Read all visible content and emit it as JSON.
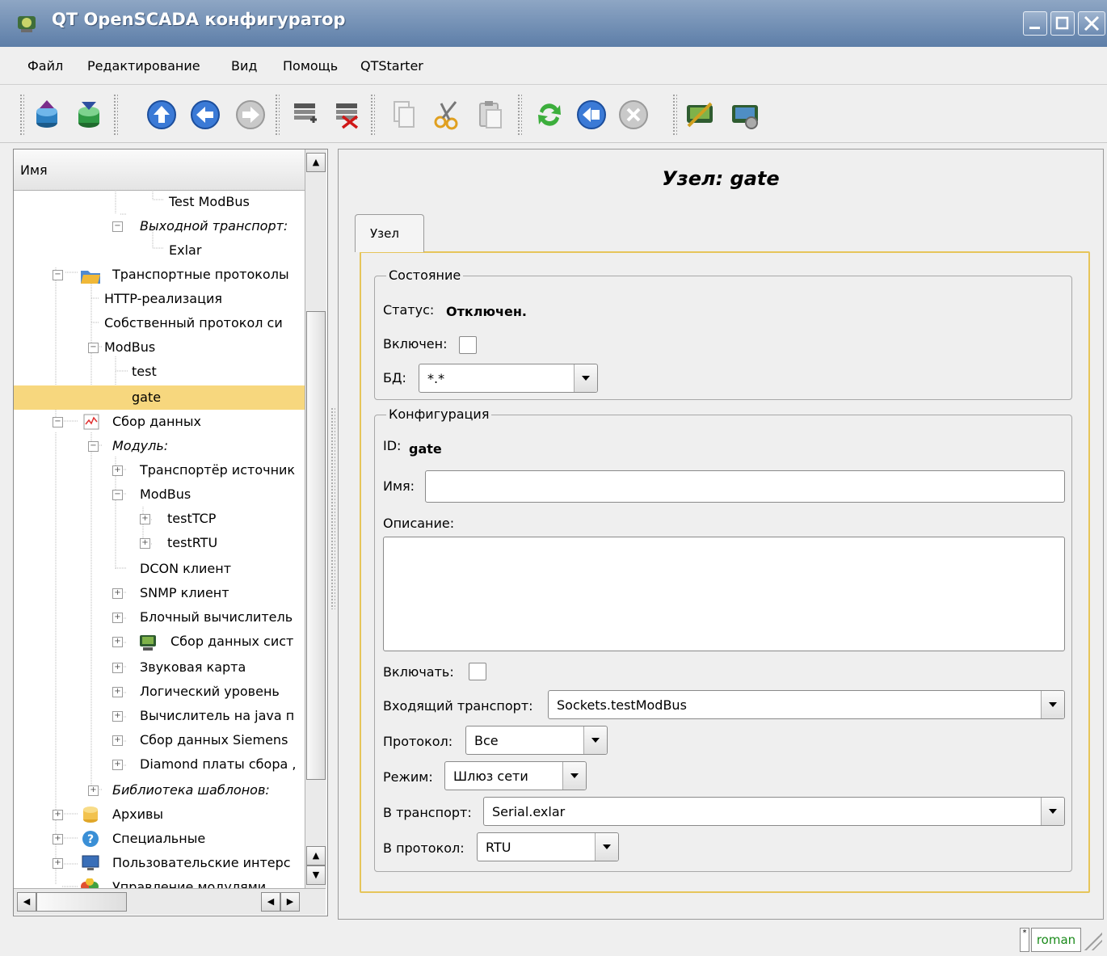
{
  "window": {
    "title": "QT OpenSCADA конфигуратор"
  },
  "menu": [
    {
      "label": "Файл"
    },
    {
      "label": "Редактирование"
    },
    {
      "label": "Вид"
    },
    {
      "label": "Помощь"
    },
    {
      "label": "QTStarter"
    }
  ],
  "toolbar": {
    "icons": [
      "load-db-icon",
      "save-db-icon",
      "up-icon",
      "back-icon",
      "forward-icon",
      "add-item-icon",
      "delete-item-icon",
      "copy-icon",
      "cut-icon",
      "paste-icon",
      "refresh-icon",
      "start-icon",
      "stop-icon",
      "configurator-icon",
      "module-manager-icon"
    ]
  },
  "tree": {
    "header": "Имя",
    "items": [
      {
        "label": "Test ModBus",
        "italic": false
      },
      {
        "label": "Выходной транспорт:",
        "italic": true
      },
      {
        "label": "Exlar",
        "italic": false
      },
      {
        "label": "Транспортные протоколы",
        "italic": false
      },
      {
        "label": "HTTP-реализация",
        "italic": false
      },
      {
        "label": "Собственный протокол си",
        "italic": false
      },
      {
        "label": "ModBus",
        "italic": false
      },
      {
        "label": "test",
        "italic": false
      },
      {
        "label": "gate",
        "italic": false
      },
      {
        "label": "Сбор данных",
        "italic": false
      },
      {
        "label": "Модуль:",
        "italic": true
      },
      {
        "label": "Транспортёр источник",
        "italic": false
      },
      {
        "label": "ModBus",
        "italic": false
      },
      {
        "label": "testTCP",
        "italic": false
      },
      {
        "label": "testRTU",
        "italic": false
      },
      {
        "label": "DCON клиент",
        "italic": false
      },
      {
        "label": "SNMP клиент",
        "italic": false
      },
      {
        "label": "Блочный вычислитель",
        "italic": false
      },
      {
        "label": "Сбор данных сист",
        "italic": false
      },
      {
        "label": "Звуковая карта",
        "italic": false
      },
      {
        "label": "Логический уровень",
        "italic": false
      },
      {
        "label": "Вычислитель на java п",
        "italic": false
      },
      {
        "label": "Сбор данных Siemens",
        "italic": false
      },
      {
        "label": "Diamond платы сбора ,",
        "italic": false
      },
      {
        "label": "Библиотека шаблонов:",
        "italic": true
      },
      {
        "label": "Архивы",
        "italic": false
      },
      {
        "label": "Специальные",
        "italic": false
      },
      {
        "label": "Пользовательские интерс",
        "italic": false
      },
      {
        "label": "Управление модулями",
        "italic": false
      }
    ],
    "selected": "gate"
  },
  "page": {
    "title": "Узел: gate",
    "tab": "Узел",
    "state_group": {
      "title": "Состояние",
      "status_label": "Статус:",
      "status_value": "Отключен.",
      "enabled_label": "Включен:",
      "db_label": "БД:",
      "db_value": "*.*"
    },
    "config_group": {
      "title": "Конфигурация",
      "id_label": "ID:",
      "id_value": "gate",
      "name_label": "Имя:",
      "name_value": "",
      "descr_label": "Описание:",
      "descr_value": "",
      "to_enable_label": "Включать:",
      "in_transport_label": "Входящий транспорт:",
      "in_transport_value": "Sockets.testModBus",
      "protocol_label": "Протокол:",
      "protocol_value": "Все",
      "mode_label": "Режим:",
      "mode_value": "Шлюз сети",
      "out_transport_label": "В транспорт:",
      "out_transport_value": "Serial.exlar",
      "out_protocol_label": "В протокол:",
      "out_protocol_value": "RTU"
    }
  },
  "status": {
    "mark": "*",
    "user": "roman"
  }
}
